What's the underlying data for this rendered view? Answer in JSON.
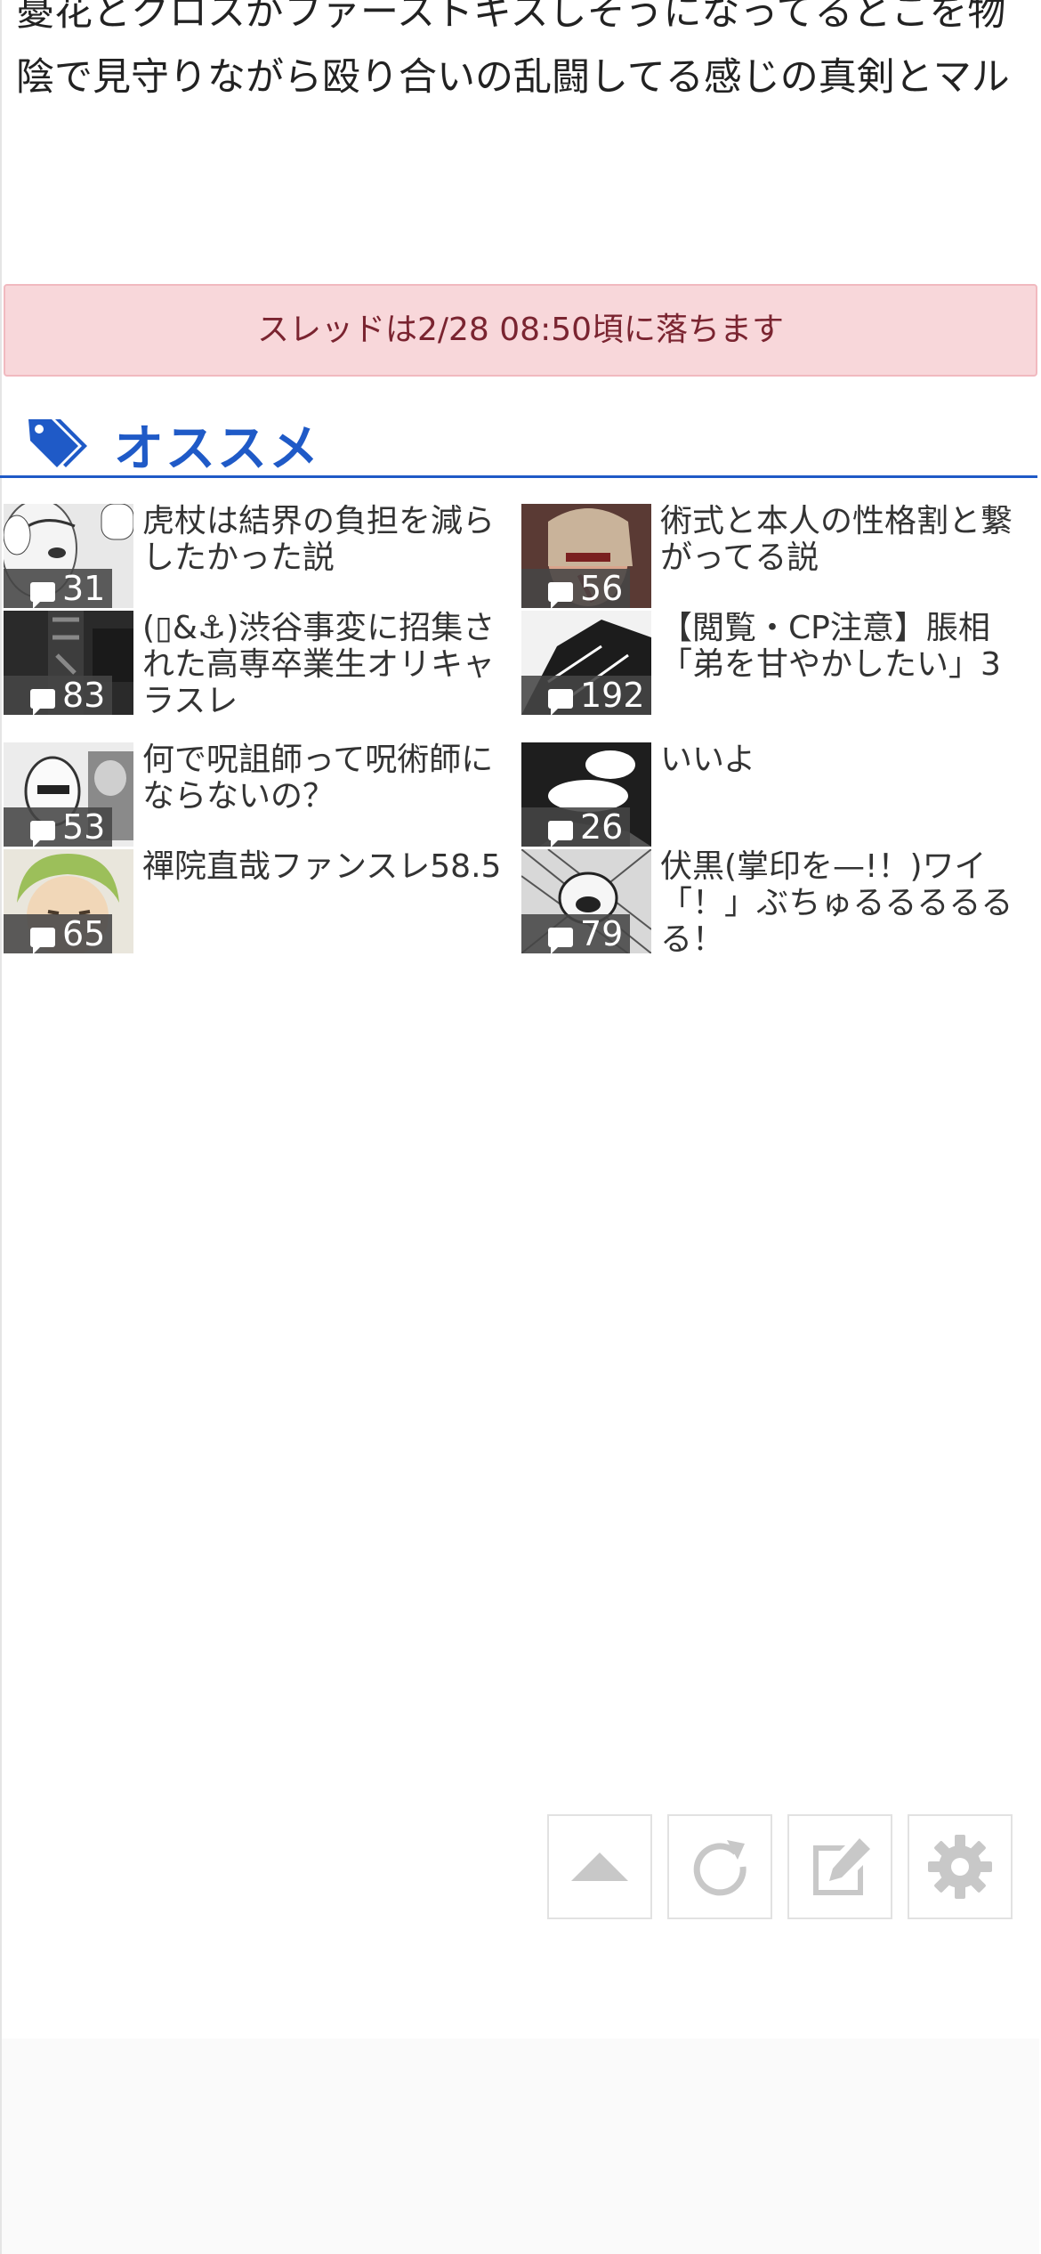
{
  "post": {
    "body": "憂花とクロスがファーストキスしそうになってるとこを物陰で見守りながら殴り合いの乱闘してる感じの真剣とマル"
  },
  "notice": {
    "text": "スレッドは2/28 08:50頃に落ちます"
  },
  "recommend": {
    "title": "オススメ",
    "icon": "tag-icon",
    "accent": "#1f5ac7",
    "items": [
      {
        "count": "31",
        "title": "虎杖は結界の負担を減らしたかった説"
      },
      {
        "count": "56",
        "title": "術式と本人の性格割と繋がってる説"
      },
      {
        "count": "83",
        "title": "(▯&⚓)渋谷事変に招集された高専卒業生オリキャラスレ"
      },
      {
        "count": "192",
        "title": "【閲覧・CP注意】脹相「弟を甘やかしたい」3"
      },
      {
        "count": "53",
        "title": "何で呪詛師って呪術師にならないの？"
      },
      {
        "count": "26",
        "title": "いいよ"
      },
      {
        "count": "65",
        "title": "禪院直哉ファンスレ58.5"
      },
      {
        "count": "79",
        "title": "伏黒(掌印を—!！)ワイ「！」ぶちゅるるるるるる！"
      }
    ]
  },
  "toolbar": {
    "buttons": [
      {
        "name": "scroll-top-button",
        "icon": "triangle-up-icon"
      },
      {
        "name": "reload-button",
        "icon": "reload-icon"
      },
      {
        "name": "write-button",
        "icon": "edit-icon"
      },
      {
        "name": "settings-button",
        "icon": "gear-icon"
      }
    ]
  },
  "notice_colors": {
    "background": "#f8d7da",
    "text": "#7a2430"
  }
}
